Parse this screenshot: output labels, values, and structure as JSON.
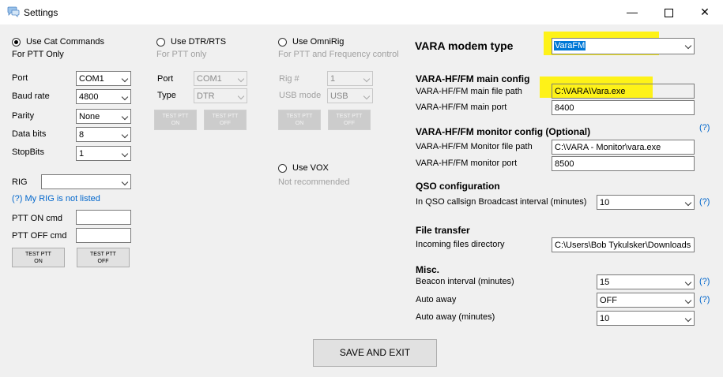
{
  "window": {
    "title": "Settings"
  },
  "cat": {
    "radio_label": "Use Cat Commands",
    "subtitle": "For PTT Only",
    "port_label": "Port",
    "port_value": "COM1",
    "baud_label": "Baud rate",
    "baud_value": "4800",
    "parity_label": "Parity",
    "parity_value": "None",
    "databits_label": "Data bits",
    "databits_value": "8",
    "stopbits_label": "StopBits",
    "stopbits_value": "1",
    "rig_label": "RIG",
    "rig_value": "",
    "rig_link": "(?) My RIG is not listed",
    "ptt_on_label": "PTT ON cmd",
    "ptt_on_value": "",
    "ptt_off_label": "PTT OFF cmd",
    "ptt_off_value": "",
    "test_on": "TEST PTT\nON",
    "test_off": "TEST PTT\nOFF"
  },
  "dtr": {
    "radio_label": "Use DTR/RTS",
    "subtitle": "For PTT only",
    "port_label": "Port",
    "port_value": "COM1",
    "type_label": "Type",
    "type_value": "DTR",
    "test_on": "TEST PTT\nON",
    "test_off": "TEST PTT\nOFF"
  },
  "omnirig": {
    "radio_label": "Use OmniRig",
    "subtitle": "For PTT and Frequency control",
    "rig_label": "Rig #",
    "rig_value": "1",
    "usb_label": "USB mode",
    "usb_value": "USB",
    "test_on": "TEST PTT\nON",
    "test_off": "TEST PTT\nOFF"
  },
  "vox": {
    "radio_label": "Use VOX",
    "subtitle": "Not recommended"
  },
  "modem": {
    "label": "VARA modem type",
    "value": "VaraFM"
  },
  "main_config": {
    "heading": "VARA-HF/FM main config",
    "path_label": "VARA-HF/FM main file path",
    "path_value": "C:\\VARA\\Vara.exe",
    "port_label": "VARA-HF/FM main port",
    "port_value": "8400"
  },
  "monitor_config": {
    "heading": "VARA-HF/FM monitor config (Optional)",
    "path_label": "VARA-HF/FM Monitor file path",
    "path_value": "C:\\VARA - Monitor\\vara.exe",
    "port_label": "VARA-HF/FM monitor port",
    "port_value": "8500"
  },
  "qso": {
    "heading": "QSO configuration",
    "interval_label": "In QSO callsign Broadcast interval (minutes)",
    "interval_value": "10"
  },
  "file_transfer": {
    "heading": "File transfer",
    "dir_label": "Incoming files directory",
    "dir_value": "C:\\Users\\Bob Tykulsker\\Downloads"
  },
  "misc": {
    "heading": "Misc.",
    "beacon_label": "Beacon interval (minutes)",
    "beacon_value": "15",
    "away_label": "Auto away",
    "away_value": "OFF",
    "away_min_label": "Auto away (minutes)",
    "away_min_value": "10"
  },
  "help_mark": "(?)",
  "save_button": "SAVE AND EXIT",
  "colors": {
    "highlight": "#fff200",
    "link": "#0066cc"
  }
}
